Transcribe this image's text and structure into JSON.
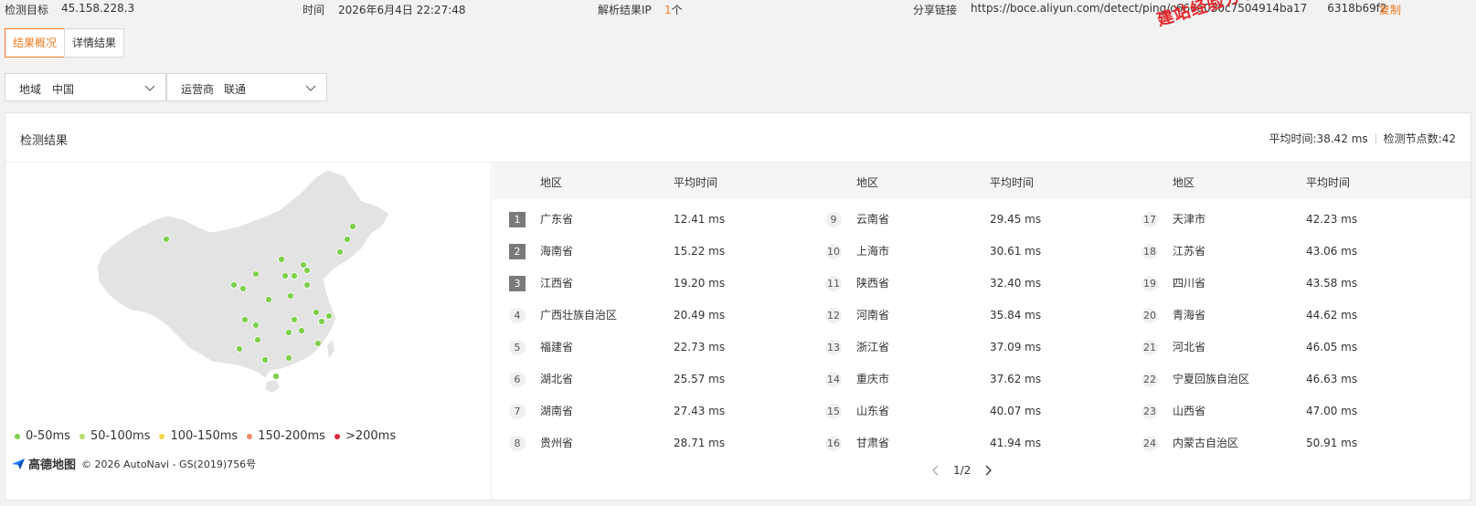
{
  "topbar": {
    "target_label": "检测目标",
    "target_value": "45.158.228.3",
    "time_label": "时间",
    "time_value": "2026年6月4日 22:27:48",
    "ip_label": "解析结果IP",
    "ip_count": "1",
    "ip_unit": "个",
    "share_label": "分享链接",
    "share_url": "https://boce.aliyun.com/detect/ping/c666a030c7504914ba17",
    "share_url_tail": "6318b69f2",
    "copy_label": "复制"
  },
  "watermark": "建站经验分享-www.",
  "tabs": [
    {
      "label": "结果概况",
      "active": true
    },
    {
      "label": "详情结果",
      "active": false
    }
  ],
  "filters": {
    "region_label": "地域",
    "region_value": "中国",
    "isp_label": "运营商",
    "isp_value": "联通"
  },
  "panel": {
    "title": "检测结果",
    "avg_time": "平均时间:38.42 ms",
    "node_count": "检测节点数:42"
  },
  "legend": [
    {
      "label": "0-50ms",
      "color": "#7ed04b"
    },
    {
      "label": "50-100ms",
      "color": "#b6e06a"
    },
    {
      "label": "100-150ms",
      "color": "#f5d64a"
    },
    {
      "label": "150-200ms",
      "color": "#f28a6a"
    },
    {
      "label": ">200ms",
      "color": "#e8233d"
    }
  ],
  "attribution": {
    "brand": "高德地图",
    "copyright": "© 2026 AutoNavi - GS(2019)756号"
  },
  "table": {
    "headers": [
      "地区",
      "平均时间"
    ],
    "rows": [
      {
        "rank": "1",
        "region": "广东省",
        "time": "12.41 ms"
      },
      {
        "rank": "2",
        "region": "海南省",
        "time": "15.22 ms"
      },
      {
        "rank": "3",
        "region": "江西省",
        "time": "19.20 ms"
      },
      {
        "rank": "4",
        "region": "广西壮族自治区",
        "time": "20.49 ms"
      },
      {
        "rank": "5",
        "region": "福建省",
        "time": "22.73 ms"
      },
      {
        "rank": "6",
        "region": "湖北省",
        "time": "25.57 ms"
      },
      {
        "rank": "7",
        "region": "湖南省",
        "time": "27.43 ms"
      },
      {
        "rank": "8",
        "region": "贵州省",
        "time": "28.71 ms"
      },
      {
        "rank": "9",
        "region": "云南省",
        "time": "29.45 ms"
      },
      {
        "rank": "10",
        "region": "上海市",
        "time": "30.61 ms"
      },
      {
        "rank": "11",
        "region": "陕西省",
        "time": "32.40 ms"
      },
      {
        "rank": "12",
        "region": "河南省",
        "time": "35.84 ms"
      },
      {
        "rank": "13",
        "region": "浙江省",
        "time": "37.09 ms"
      },
      {
        "rank": "14",
        "region": "重庆市",
        "time": "37.62 ms"
      },
      {
        "rank": "15",
        "region": "山东省",
        "time": "40.07 ms"
      },
      {
        "rank": "16",
        "region": "甘肃省",
        "time": "41.94 ms"
      },
      {
        "rank": "17",
        "region": "天津市",
        "time": "42.23 ms"
      },
      {
        "rank": "18",
        "region": "江苏省",
        "time": "43.06 ms"
      },
      {
        "rank": "19",
        "region": "四川省",
        "time": "43.58 ms"
      },
      {
        "rank": "20",
        "region": "青海省",
        "time": "44.62 ms"
      },
      {
        "rank": "21",
        "region": "河北省",
        "time": "46.05 ms"
      },
      {
        "rank": "22",
        "region": "宁夏回族自治区",
        "time": "46.63 ms"
      },
      {
        "rank": "23",
        "region": "山西省",
        "time": "47.00 ms"
      },
      {
        "rank": "24",
        "region": "内蒙古自治区",
        "time": "50.91 ms"
      }
    ]
  },
  "pagination": {
    "page": "1/2",
    "prev_icon": "chevron-left-icon",
    "next_icon": "chevron-right-icon"
  }
}
